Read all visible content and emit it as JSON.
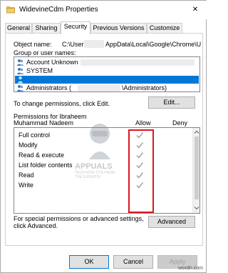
{
  "window": {
    "title": "WidevineCdm Properties",
    "close_glyph": "✕"
  },
  "tabs": [
    {
      "label": "General"
    },
    {
      "label": "Sharing"
    },
    {
      "label": "Security"
    },
    {
      "label": "Previous Versions"
    },
    {
      "label": "Customize"
    }
  ],
  "security": {
    "object_name_label": "Object name:",
    "object_name_prefix": "C:\\User",
    "object_name_suffix": "AppData\\Local\\Google\\Chrome\\U",
    "groups_label": "Group or user names:",
    "groups": [
      {
        "label": "Account Unknown",
        "selected": false,
        "icon": "users-icon"
      },
      {
        "label": "SYSTEM",
        "selected": false,
        "icon": "users-icon"
      },
      {
        "label": "",
        "selected": true,
        "icon": "user-icon"
      },
      {
        "label": "Administrators (",
        "suffix": "\\Administrators)",
        "selected": false,
        "icon": "users-icon"
      }
    ],
    "change_hint": "To change permissions, click Edit.",
    "edit_button": "Edit...",
    "permissions_for_line1": "Permissions for Ibraheem",
    "permissions_for_line2": "Muhammad Nadeem",
    "allow_header": "Allow",
    "deny_header": "Deny",
    "permissions": [
      {
        "name": "Full control",
        "allow": true,
        "deny": false
      },
      {
        "name": "Modify",
        "allow": true,
        "deny": false
      },
      {
        "name": "Read & execute",
        "allow": true,
        "deny": false
      },
      {
        "name": "List folder contents",
        "allow": true,
        "deny": false
      },
      {
        "name": "Read",
        "allow": true,
        "deny": false
      },
      {
        "name": "Write",
        "allow": true,
        "deny": false
      }
    ],
    "special_hint_line1": "For special permissions or advanced settings,",
    "special_hint_line2": "click Advanced.",
    "advanced_button": "Advanced"
  },
  "footer": {
    "ok": "OK",
    "cancel": "Cancel",
    "apply": "Apply"
  },
  "watermark": {
    "brand": "APPUALS",
    "tagline_1": "TECH HOW-TO'S FROM",
    "tagline_2": "THE EXPERTS!"
  },
  "site_mark": "wsxdn.com",
  "colors": {
    "selection": "#0078d7",
    "highlight_box": "#d9181f",
    "check_grey": "#9a9a9a"
  }
}
